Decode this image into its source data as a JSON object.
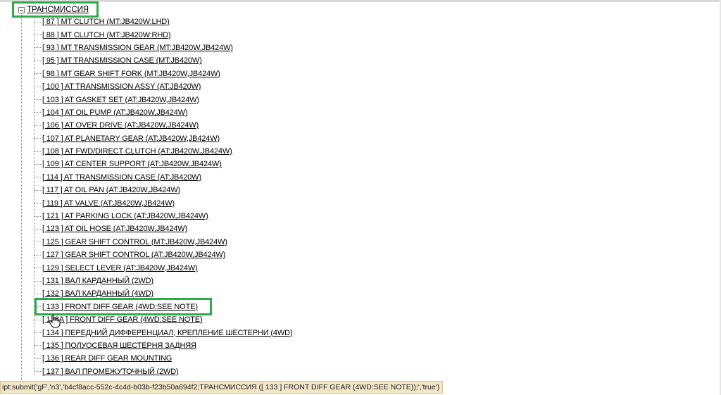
{
  "tree": {
    "root_label": "ТРАНСМИССИЯ",
    "items": [
      "[ 87 ] MT CLUTCH (MT:JB420W:LHD)",
      "[ 88 ] MT CLUTCH (MT:JB420W:RHD)",
      "[ 93 ] MT TRANSMISSION GEAR (MT:JB420W,JB424W)",
      "[ 95 ] MT TRANSMISSION CASE (MT:JB420W)",
      "[ 98 ] MT GEAR SHIFT FORK (MT:JB420W,JB424W)",
      "[ 100 ] AT TRANSMISSION ASSY (AT:JB420W)",
      "[ 103 ] AT GASKET SET (AT:JB420W,JB424W)",
      "[ 104 ] AT OIL PUMP (AT:JB420W,JB424W)",
      "[ 106 ] AT OVER DRIVE (AT:JB420W,JB424W)",
      "[ 107 ] AT PLANETARY GEAR (AT:JB420W,JB424W)",
      "[ 108 ] AT FWD/DIRECT CLUTCH (AT:JB420W,JB424W)",
      "[ 109 ] AT CENTER SUPPORT (AT:JB420W,JB424W)",
      "[ 114 ] AT TRANSMISSION CASE (AT:JB420W)",
      "[ 117 ] AT OIL PAN (AT:JB420W,JB424W)",
      "[ 119 ] AT VALVE (AT:JB420W,JB424W)",
      "[ 121 ] AT PARKING LOCK (AT:JB420W,JB424W)",
      "[ 123 ] AT OIL HOSE (AT:JB420W,JB424W)",
      "[ 125 ] GEAR SHIFT CONTROL (MT:JB420W,JB424W)",
      "[ 127 ] GEAR SHIFT CONTROL (AT:JB420W,JB424W)",
      "[ 129 ] SELECT LEVER (AT:JB420W,JB424W)",
      "[ 131 ] ВАЛ КАРДАННЫЙ (2WD)",
      "[ 132 ] ВАЛ КАРДАННЫЙ (4WD)",
      "[ 133 ] FRONT DIFF GEAR (4WD:SEE NOTE)",
      "[ 133A ] FRONT DIFF GEAR (4WD:SEE NOTE)",
      "[ 134 ] ПЕРЕДНИЙ ДИФФЕРЕНЦИАЛ, КРЕПЛЕНИЕ ШЕСТЕРНИ (4WD)",
      "[ 135 ] ПОЛУОСЕВАЯ ШЕСТЕРНЯ ЗАДНЯЯ",
      "[ 136 ] REAR DIFF GEAR MOUNTING",
      "[ 137 ] ВАЛ ПРОМЕЖУТОЧНЫЙ (2WD)"
    ],
    "toggle_icon": "minus-box-icon"
  },
  "status": {
    "text": "ipt:submit('gF','n3','b4cf8acc-552c-4c4d-b03b-f23b50a694f2;ТРАНСМИССИЯ ([ 133 ]  FRONT DIFF GEAR (4WD:SEE NOTE));','true')"
  },
  "colors": {
    "highlight": "#2eaa4a",
    "statusbar_bg": "#f2e6c6"
  }
}
